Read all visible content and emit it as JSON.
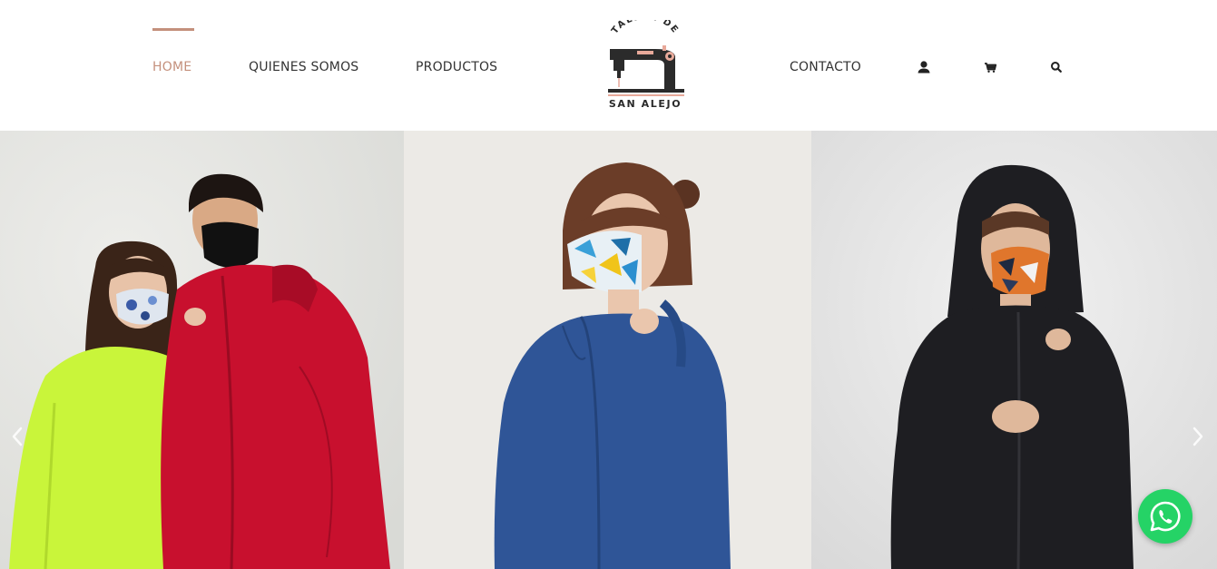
{
  "header": {
    "nav_left": [
      {
        "label": "HOME",
        "active": true
      },
      {
        "label": "QUIENES SOMOS",
        "active": false
      },
      {
        "label": "PRODUCTOS",
        "active": false
      }
    ],
    "nav_right": [
      {
        "label": "CONTACTO",
        "active": false
      }
    ],
    "logo": {
      "text_top": "TALLER DE",
      "text_bottom": "SAN ALEJO"
    },
    "icons": [
      "user-icon",
      "cart-icon",
      "search-icon"
    ]
  },
  "hero": {
    "slides": [
      "slide-couple-jackets",
      "slide-blue-jacket",
      "slide-black-hooded-jacket"
    ],
    "prev_icon": "chevron-left-icon",
    "next_icon": "chevron-right-icon"
  },
  "floating": {
    "whatsapp_icon": "whatsapp-icon"
  },
  "colors": {
    "accent": "#c4907c",
    "nav_text": "#333333",
    "whatsapp": "#25d366",
    "jacket_neon": "#c9f53a",
    "jacket_red": "#c8102e",
    "jacket_blue": "#2f5597",
    "jacket_black": "#1e1e22"
  }
}
